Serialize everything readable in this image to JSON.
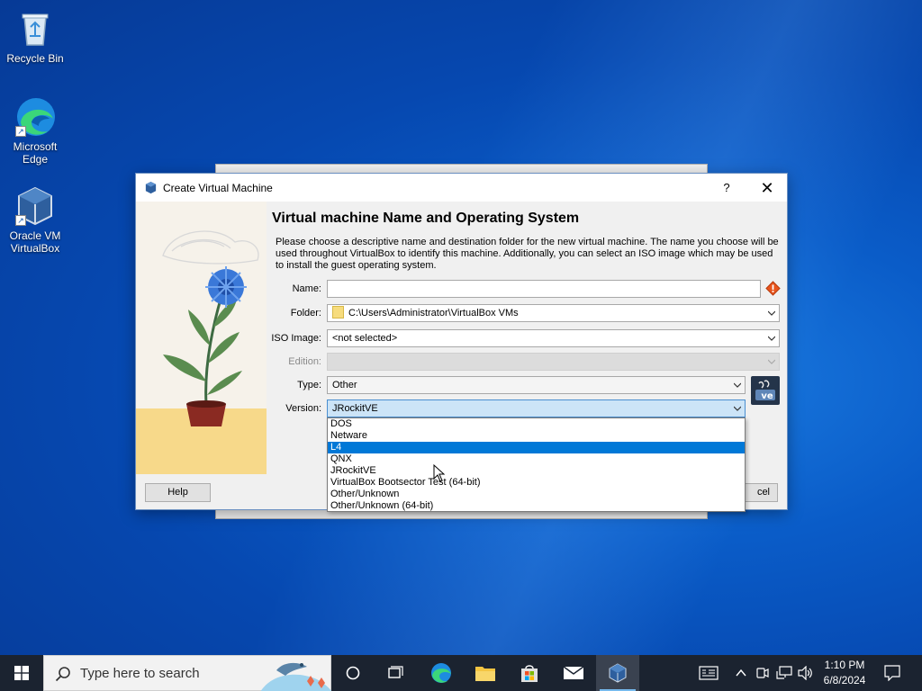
{
  "desktop": {
    "icons": [
      {
        "label": "Recycle Bin"
      },
      {
        "label": "Microsoft Edge"
      },
      {
        "label": "Oracle VM VirtualBox"
      }
    ]
  },
  "dialog": {
    "title": "Create Virtual Machine",
    "help_glyph": "?",
    "close_glyph": "✕",
    "heading": "Virtual machine Name and Operating System",
    "description": "Please choose a descriptive name and destination folder for the new virtual machine. The name you choose will be used throughout VirtualBox to identify this machine. Additionally, you can select an ISO image which may be used to install the guest operating system.",
    "fields": {
      "name": {
        "label": "Name:",
        "value": ""
      },
      "folder": {
        "label": "Folder:",
        "value": "C:\\Users\\Administrator\\VirtualBox VMs"
      },
      "iso": {
        "label": "ISO Image:",
        "value": "<not selected>"
      },
      "edition": {
        "label": "Edition:",
        "value": ""
      },
      "type": {
        "label": "Type:",
        "value": "Other"
      },
      "version": {
        "label": "Version:",
        "value": "JRockitVE"
      }
    },
    "buttons": {
      "help": "Help",
      "cancel_partial": "cel"
    },
    "version_options": [
      "DOS",
      "Netware",
      "L4",
      "QNX",
      "JRockitVE",
      "VirtualBox Bootsector Test (64-bit)",
      "Other/Unknown",
      "Other/Unknown (64-bit)"
    ],
    "version_highlighted": "L4",
    "os_badge_text": "ve"
  },
  "taskbar": {
    "search_placeholder": "Type here to search",
    "time": "1:10 PM",
    "date": "6/8/2024"
  },
  "colors": {
    "accent": "#0078d7",
    "taskbar": "#1b2330",
    "warning": "#e8541c"
  }
}
